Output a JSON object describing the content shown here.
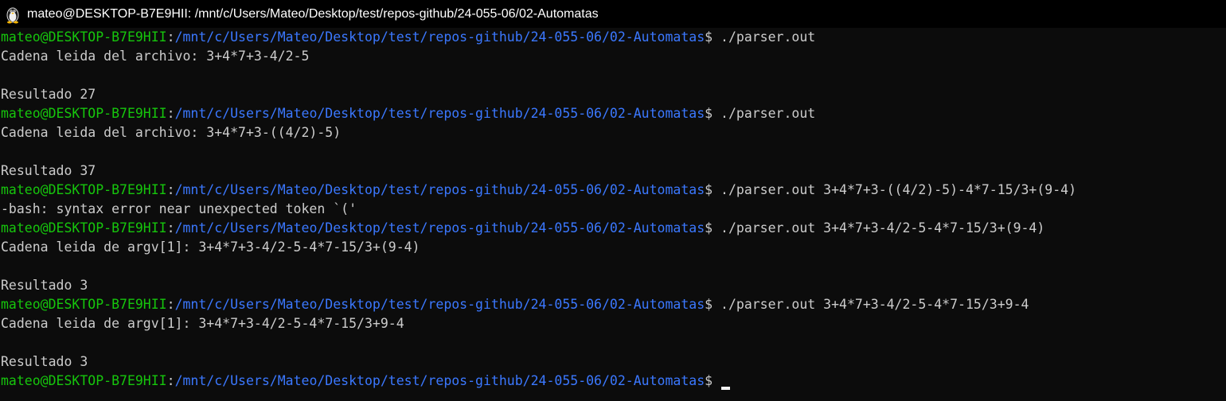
{
  "window": {
    "title": "mateo@DESKTOP-B7E9HII: /mnt/c/Users/Mateo/Desktop/test/repos-github/24-055-06/02-Automatas",
    "icon": "linux-penguin-icon"
  },
  "prompt": {
    "user": "mateo@DESKTOP-B7E9HII",
    "separator": ":",
    "path": "/mnt/c/Users/Mateo/Desktop/test/repos-github/24-055-06/02-Automatas",
    "symbol": "$ "
  },
  "colors": {
    "background": "#0c0c0c",
    "user": "#16c60c",
    "path": "#3b78ff",
    "text": "#cccccc"
  },
  "terminal": {
    "lines": [
      {
        "type": "prompt",
        "command": "./parser.out"
      },
      {
        "type": "output",
        "text": "Cadena leida del archivo: 3+4*7+3-4/2-5"
      },
      {
        "type": "output",
        "text": ""
      },
      {
        "type": "output",
        "text": "Resultado 27"
      },
      {
        "type": "prompt",
        "command": "./parser.out"
      },
      {
        "type": "output",
        "text": "Cadena leida del archivo: 3+4*7+3-((4/2)-5)"
      },
      {
        "type": "output",
        "text": ""
      },
      {
        "type": "output",
        "text": "Resultado 37"
      },
      {
        "type": "prompt",
        "command": "./parser.out 3+4*7+3-((4/2)-5)-4*7-15/3+(9-4)"
      },
      {
        "type": "output",
        "text": "-bash: syntax error near unexpected token `('"
      },
      {
        "type": "prompt",
        "command": "./parser.out 3+4*7+3-4/2-5-4*7-15/3+(9-4)"
      },
      {
        "type": "output",
        "text": "Cadena leida de argv[1]: 3+4*7+3-4/2-5-4*7-15/3+(9-4)"
      },
      {
        "type": "output",
        "text": ""
      },
      {
        "type": "output",
        "text": "Resultado 3"
      },
      {
        "type": "prompt",
        "command": "./parser.out 3+4*7+3-4/2-5-4*7-15/3+9-4"
      },
      {
        "type": "output",
        "text": "Cadena leida de argv[1]: 3+4*7+3-4/2-5-4*7-15/3+9-4"
      },
      {
        "type": "output",
        "text": ""
      },
      {
        "type": "output",
        "text": "Resultado 3"
      },
      {
        "type": "prompt",
        "command": "",
        "cursor": true
      }
    ]
  }
}
